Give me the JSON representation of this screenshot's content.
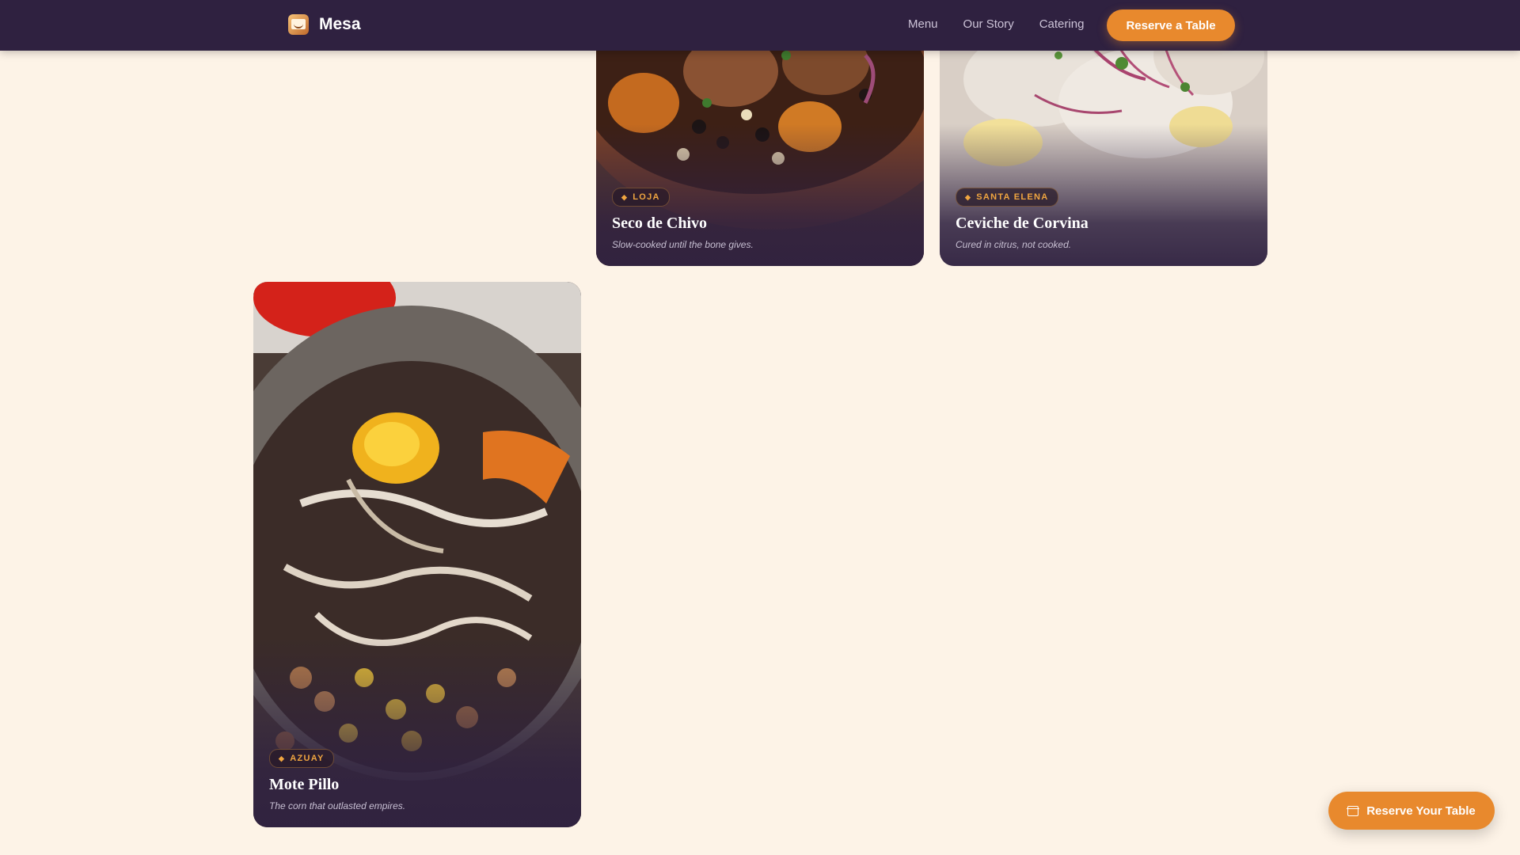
{
  "nav": {
    "brand": "Mesa",
    "links": [
      "Menu",
      "Our Story",
      "Catering"
    ],
    "cta": "Reserve a Table"
  },
  "dishes": [
    {
      "region": "LOJA",
      "title": "Seco de Chivo",
      "subtitle": "Slow-cooked until the bone gives."
    },
    {
      "region": "SANTA ELENA",
      "title": "Ceviche de Corvina",
      "subtitle": "Cured in citrus, not cooked."
    },
    {
      "region": "AZUAY",
      "title": "Mote Pillo",
      "subtitle": "The corn that outlasted empires."
    }
  ],
  "floating_cta": {
    "label": "Reserve Your Table",
    "icon": "calendar-icon"
  },
  "colors": {
    "nav_bg": "#2f2140",
    "accent": "#e8892d",
    "page_bg": "#fdf3e7",
    "badge_text": "#f0a640"
  }
}
